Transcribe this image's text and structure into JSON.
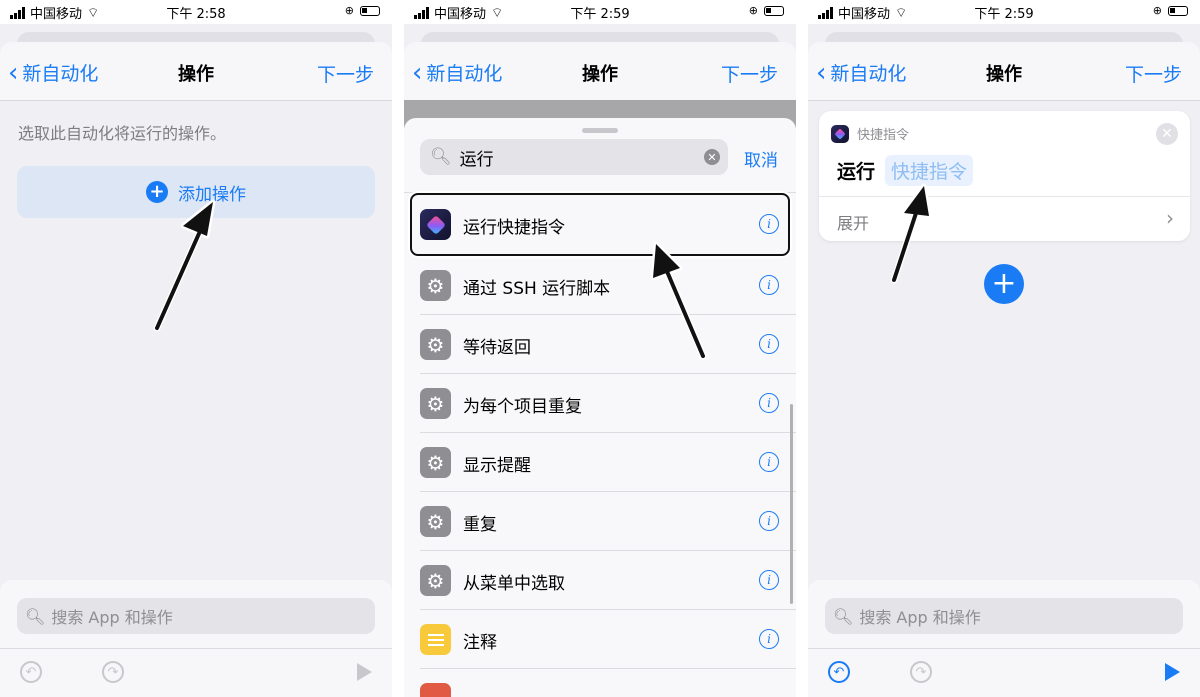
{
  "status": [
    {
      "carrier": "中国移动",
      "time": "下午 2:58"
    },
    {
      "carrier": "中国移动",
      "time": "下午 2:59"
    },
    {
      "carrier": "中国移动",
      "time": "下午 2:59"
    }
  ],
  "nav": {
    "back": "新自动化",
    "title": "操作",
    "next": "下一步"
  },
  "panel1": {
    "hint": "选取此自动化将运行的操作。",
    "add_action": "添加操作",
    "search_placeholder": "搜索 App 和操作"
  },
  "panel2": {
    "search_value": "运行",
    "cancel": "取消",
    "actions": [
      {
        "label": "运行快捷指令",
        "icon": "shortcuts-icon"
      },
      {
        "label": "通过 SSH 运行脚本",
        "icon": "gear-icon"
      },
      {
        "label": "等待返回",
        "icon": "gear-icon"
      },
      {
        "label": "为每个项目重复",
        "icon": "gear-icon"
      },
      {
        "label": "显示提醒",
        "icon": "gear-icon"
      },
      {
        "label": "重复",
        "icon": "gear-icon"
      },
      {
        "label": "从菜单中选取",
        "icon": "gear-icon"
      },
      {
        "label": "注释",
        "icon": "notes-icon"
      }
    ]
  },
  "panel3": {
    "app_name": "快捷指令",
    "run_label": "运行",
    "param_placeholder": "快捷指令",
    "expand": "展开",
    "search_placeholder": "搜索 App 和操作"
  },
  "colors": {
    "accent": "#1a7cf5",
    "annotation_arrow": "#111111"
  }
}
